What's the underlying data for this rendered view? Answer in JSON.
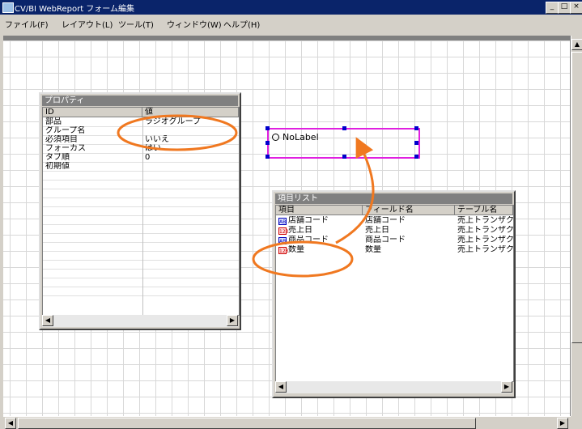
{
  "window": {
    "title": "CV/BI WebReport フォーム編集",
    "btn_min": "_",
    "btn_max": "□",
    "btn_close": "×"
  },
  "menu": [
    "ファイル(F)",
    "レイアウト(L)",
    "ツール(T)",
    "ウィンドウ(W)",
    "ヘルプ(H)"
  ],
  "properties": {
    "title": "プロパティ",
    "col_id": "ID",
    "col_value": "値",
    "rows": [
      {
        "id": "部品",
        "value": "ラジオグループ"
      },
      {
        "id": "グループ名",
        "value": ""
      },
      {
        "id": "必須項目",
        "value": "いいえ"
      },
      {
        "id": "フォーカス",
        "value": "はい"
      },
      {
        "id": "タブ順",
        "value": "0"
      },
      {
        "id": "初期値",
        "value": ""
      }
    ]
  },
  "label_control": {
    "text": "NoLabel"
  },
  "field_list": {
    "title": "項目リスト",
    "col_item": "項目",
    "col_field": "フィールド名",
    "col_table": "テーブル名",
    "rows": [
      {
        "icon": "text-icon",
        "item": "店舗コード",
        "field": "店舗コード",
        "table": "売上トランザクシ"
      },
      {
        "icon": "number-icon",
        "item": "売上日",
        "field": "売上日",
        "table": "売上トランザクシ"
      },
      {
        "icon": "text-icon",
        "item": "商品コード",
        "field": "商品コード",
        "table": "売上トランザクシ"
      },
      {
        "icon": "number-icon",
        "item": "数量",
        "field": "数量",
        "table": "売上トランザクシ"
      }
    ]
  },
  "icons": {
    "text_glyph": "AB",
    "number_glyph": "123"
  },
  "colors": {
    "highlight": "#f07820",
    "selection": "#e020e0"
  }
}
